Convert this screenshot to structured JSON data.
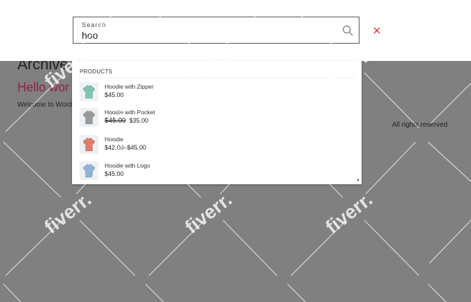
{
  "background": {
    "archive_title": "Archive",
    "hello_text": "Hello wor",
    "welcome_text": "Welcome to Word",
    "rights_text": "All rights reserved"
  },
  "search": {
    "label": "Search",
    "value": "hoo"
  },
  "dropdown": {
    "heading": "PRODUCTS",
    "results": [
      {
        "name": "Hoodie with Zipper",
        "price": "$45.00",
        "thumb_color": "#7fc4b0"
      },
      {
        "name": "Hoodie with Pocket",
        "old_price": "$45.00",
        "price": "$35.00",
        "thumb_color": "#9a9a9a"
      },
      {
        "name": "Hoodie",
        "price": "$42.00–$45.00",
        "thumb_color": "#e37b6a"
      },
      {
        "name": "Hoodie with Logo",
        "price": "$45.00",
        "thumb_color": "#8fb4d6"
      }
    ]
  },
  "watermark": {
    "text": "fiverr."
  },
  "colors": {
    "accent": "#8e2240",
    "close": "#dd3333",
    "overlay": "#808080"
  }
}
